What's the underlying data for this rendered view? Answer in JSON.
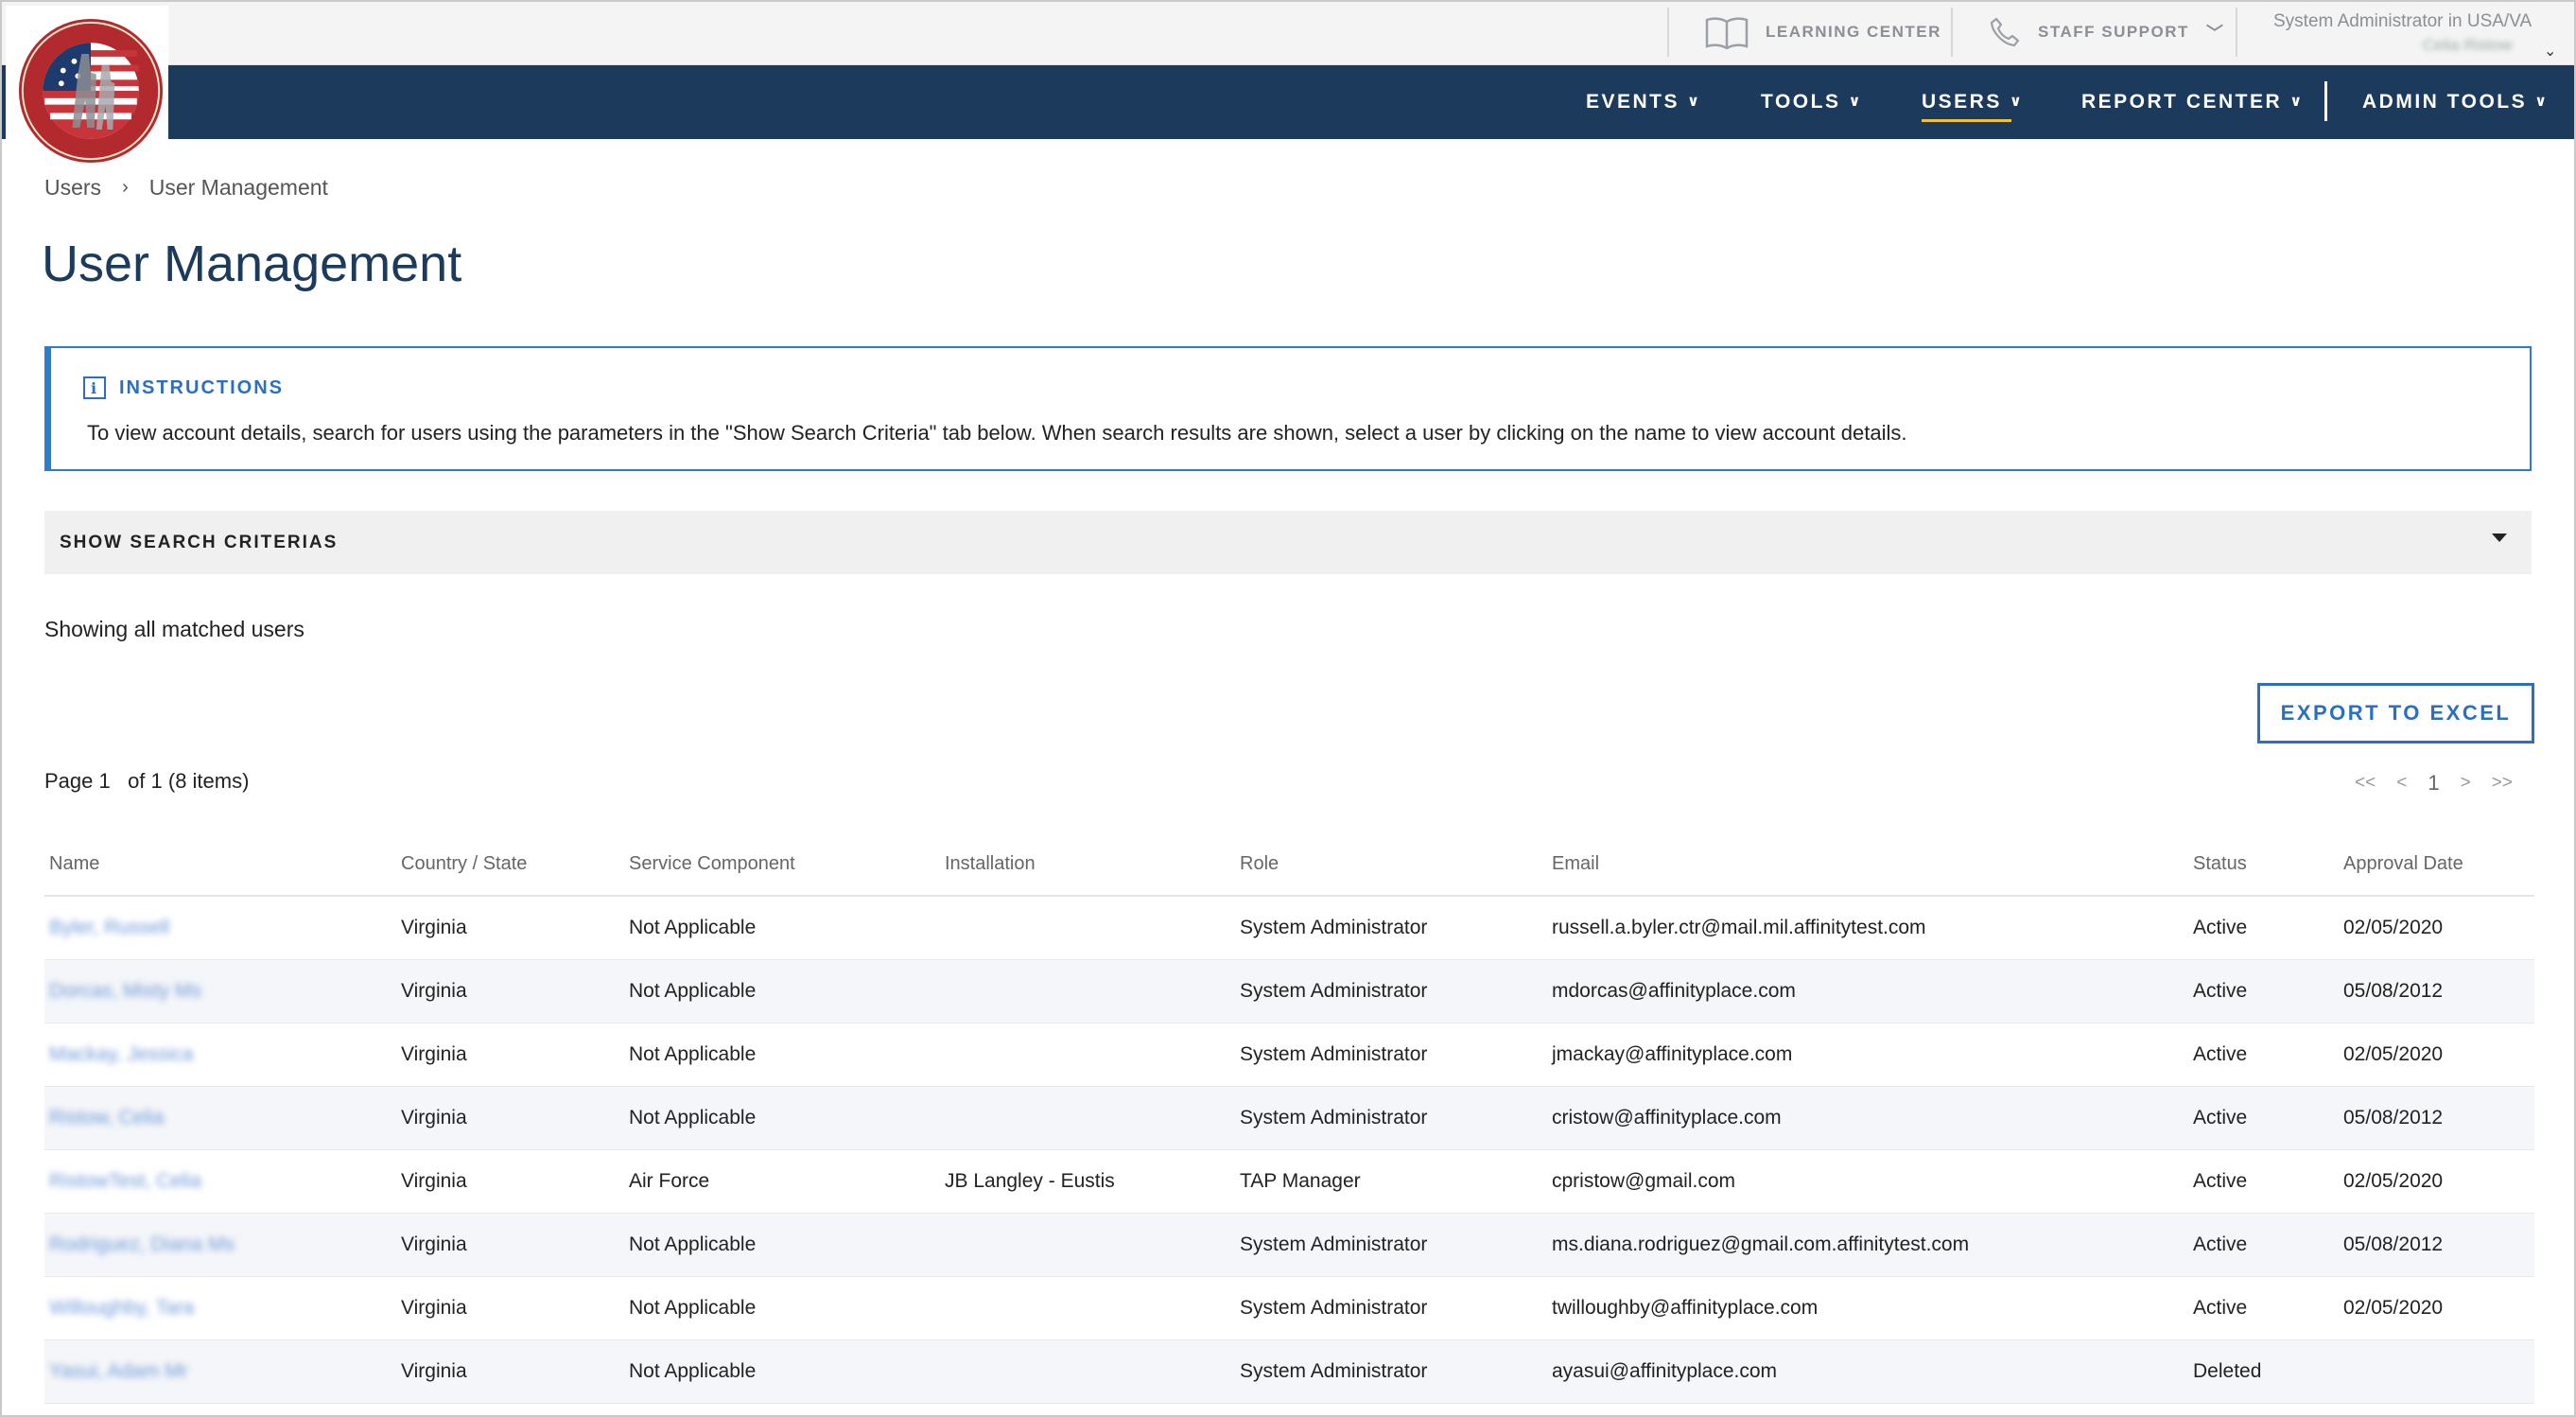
{
  "utility": {
    "learning_center": "LEARNING CENTER",
    "staff_support": "STAFF SUPPORT",
    "user_role": "System Administrator in USA/VA",
    "user_name": "Celia Ristow"
  },
  "nav": {
    "items": [
      {
        "label": "EVENTS"
      },
      {
        "label": "TOOLS"
      },
      {
        "label": "USERS",
        "active": true
      },
      {
        "label": "REPORT CENTER"
      },
      {
        "label": "ADMIN TOOLS"
      }
    ]
  },
  "breadcrumb": {
    "items": [
      "Users",
      "User Management"
    ],
    "separator": "›"
  },
  "page": {
    "title": "User Management",
    "instructions_heading": "INSTRUCTIONS",
    "instructions_text": "To view account details, search for users using the parameters in the \"Show Search Criteria\" tab below. When search results are shown, select a user by clicking on the name to view account details.",
    "criteria_label": "SHOW SEARCH CRITERIAS",
    "matched_text": "Showing all matched users",
    "export_label": "EXPORT TO EXCEL",
    "page_info": "Page 1   of 1 (8 items)"
  },
  "pager": {
    "first": "<<",
    "prev": "<",
    "current": "1",
    "next": ">",
    "last": ">>"
  },
  "table": {
    "columns": [
      "Name",
      "Country / State",
      "Service Component",
      "Installation",
      "Role",
      "Email",
      "Status",
      "Approval Date"
    ],
    "rows": [
      {
        "name": "Byler, Russell",
        "state": "Virginia",
        "component": "Not Applicable",
        "installation": "",
        "role": "System Administrator",
        "email": "russell.a.byler.ctr@mail.mil.affinitytest.com",
        "status": "Active",
        "date": "02/05/2020"
      },
      {
        "name": "Dorcas, Misty Ms",
        "state": "Virginia",
        "component": "Not Applicable",
        "installation": "",
        "role": "System Administrator",
        "email": "mdorcas@affinityplace.com",
        "status": "Active",
        "date": "05/08/2012"
      },
      {
        "name": "Mackay, Jessica",
        "state": "Virginia",
        "component": "Not Applicable",
        "installation": "",
        "role": "System Administrator",
        "email": "jmackay@affinityplace.com",
        "status": "Active",
        "date": "02/05/2020"
      },
      {
        "name": "Ristow, Celia",
        "state": "Virginia",
        "component": "Not Applicable",
        "installation": "",
        "role": "System Administrator",
        "email": "cristow@affinityplace.com",
        "status": "Active",
        "date": "05/08/2012"
      },
      {
        "name": "RistowTest, Celia",
        "state": "Virginia",
        "component": "Air Force",
        "installation": "JB Langley - Eustis",
        "role": "TAP Manager",
        "email": "cpristow@gmail.com",
        "status": "Active",
        "date": "02/05/2020"
      },
      {
        "name": "Rodriguez, Diana Ms",
        "state": "Virginia",
        "component": "Not Applicable",
        "installation": "",
        "role": "System Administrator",
        "email": "ms.diana.rodriguez@gmail.com.affinitytest.com",
        "status": "Active",
        "date": "05/08/2012"
      },
      {
        "name": "Willoughby, Tara",
        "state": "Virginia",
        "component": "Not Applicable",
        "installation": "",
        "role": "System Administrator",
        "email": "twilloughby@affinityplace.com",
        "status": "Active",
        "date": "02/05/2020"
      },
      {
        "name": "Yasui, Adam Mr",
        "state": "Virginia",
        "component": "Not Applicable",
        "installation": "",
        "role": "System Administrator",
        "email": "ayasui@affinityplace.com",
        "status": "Deleted",
        "date": ""
      }
    ]
  },
  "colors": {
    "nav_bg": "#1c3a5c",
    "accent": "#2a6fc2",
    "active_underline": "#f2c230",
    "link": "#6e9ad9"
  },
  "icons": {
    "learning_center": "book-icon",
    "staff_support": "phone-icon",
    "info": "info-icon",
    "logo": "tap-seal-logo"
  }
}
